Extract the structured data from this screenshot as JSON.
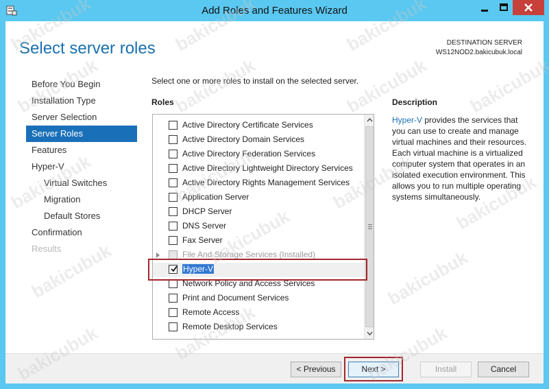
{
  "window": {
    "title": "Add Roles and Features Wizard"
  },
  "header": {
    "page_title": "Select server roles",
    "destination_label": "DESTINATION SERVER",
    "destination_server": "WS12NOD2.bakicubuk.local"
  },
  "nav": {
    "items": [
      {
        "label": "Before You Begin"
      },
      {
        "label": "Installation Type"
      },
      {
        "label": "Server Selection"
      },
      {
        "label": "Server Roles"
      },
      {
        "label": "Features"
      },
      {
        "label": "Hyper-V"
      },
      {
        "label": "Virtual Switches"
      },
      {
        "label": "Migration"
      },
      {
        "label": "Default Stores"
      },
      {
        "label": "Confirmation"
      },
      {
        "label": "Results"
      }
    ]
  },
  "main": {
    "instruction": "Select one or more roles to install on the selected server.",
    "roles_header": "Roles",
    "roles": [
      {
        "label": "Active Directory Certificate Services"
      },
      {
        "label": "Active Directory Domain Services"
      },
      {
        "label": "Active Directory Federation Services"
      },
      {
        "label": "Active Directory Lightweight Directory Services"
      },
      {
        "label": "Active Directory Rights Management Services"
      },
      {
        "label": "Application Server"
      },
      {
        "label": "DHCP Server"
      },
      {
        "label": "DNS Server"
      },
      {
        "label": "Fax Server"
      },
      {
        "label": "File And Storage Services (Installed)"
      },
      {
        "label": "Hyper-V"
      },
      {
        "label": "Network Policy and Access Services"
      },
      {
        "label": "Print and Document Services"
      },
      {
        "label": "Remote Access"
      },
      {
        "label": "Remote Desktop Services"
      }
    ]
  },
  "description": {
    "header": "Description",
    "highlight": "Hyper-V",
    "text": " provides the services that you can use to create and manage virtual machines and their resources. Each virtual machine is a virtualized computer system that operates in an isolated execution environment. This allows you to run multiple operating systems simultaneously."
  },
  "footer": {
    "previous": "< Previous",
    "next": "Next >",
    "install": "Install",
    "cancel": "Cancel"
  },
  "watermark": "bakicubuk"
}
